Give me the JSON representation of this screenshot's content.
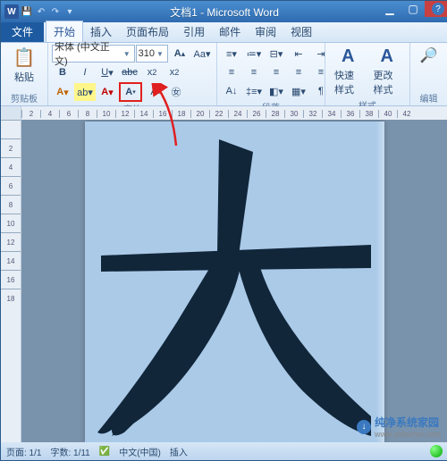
{
  "titlebar": {
    "title": "文档1 - Microsoft Word"
  },
  "tabs": {
    "file": "文件",
    "items": [
      "开始",
      "插入",
      "页面布局",
      "引用",
      "邮件",
      "审阅",
      "视图"
    ],
    "active_index": 0
  },
  "clipboard": {
    "label": "剪贴板",
    "paste": "粘贴"
  },
  "font": {
    "group_label": "字体",
    "name": "宋体 (中文正文)",
    "size": "310"
  },
  "paragraph": {
    "group_label": "段落"
  },
  "styles": {
    "group_label": "样式",
    "quick": "快速样式",
    "change": "更改样式"
  },
  "editing": {
    "group_label": "编辑"
  },
  "ruler_h": [
    "2",
    "4",
    "6",
    "8",
    "10",
    "12",
    "14",
    "16",
    "18",
    "20",
    "22",
    "24",
    "26",
    "28",
    "30",
    "32",
    "34",
    "36",
    "38",
    "40",
    "42"
  ],
  "ruler_v": [
    "",
    "2",
    "4",
    "6",
    "8",
    "10",
    "12",
    "14",
    "16",
    "18"
  ],
  "status": {
    "page": "页面: 1/1",
    "words": "字数: 1/11",
    "lang": "中文(中国)",
    "insert": "插入"
  },
  "watermark": {
    "brand": "纯净系统家园",
    "url": "www.yidaimei.com"
  }
}
